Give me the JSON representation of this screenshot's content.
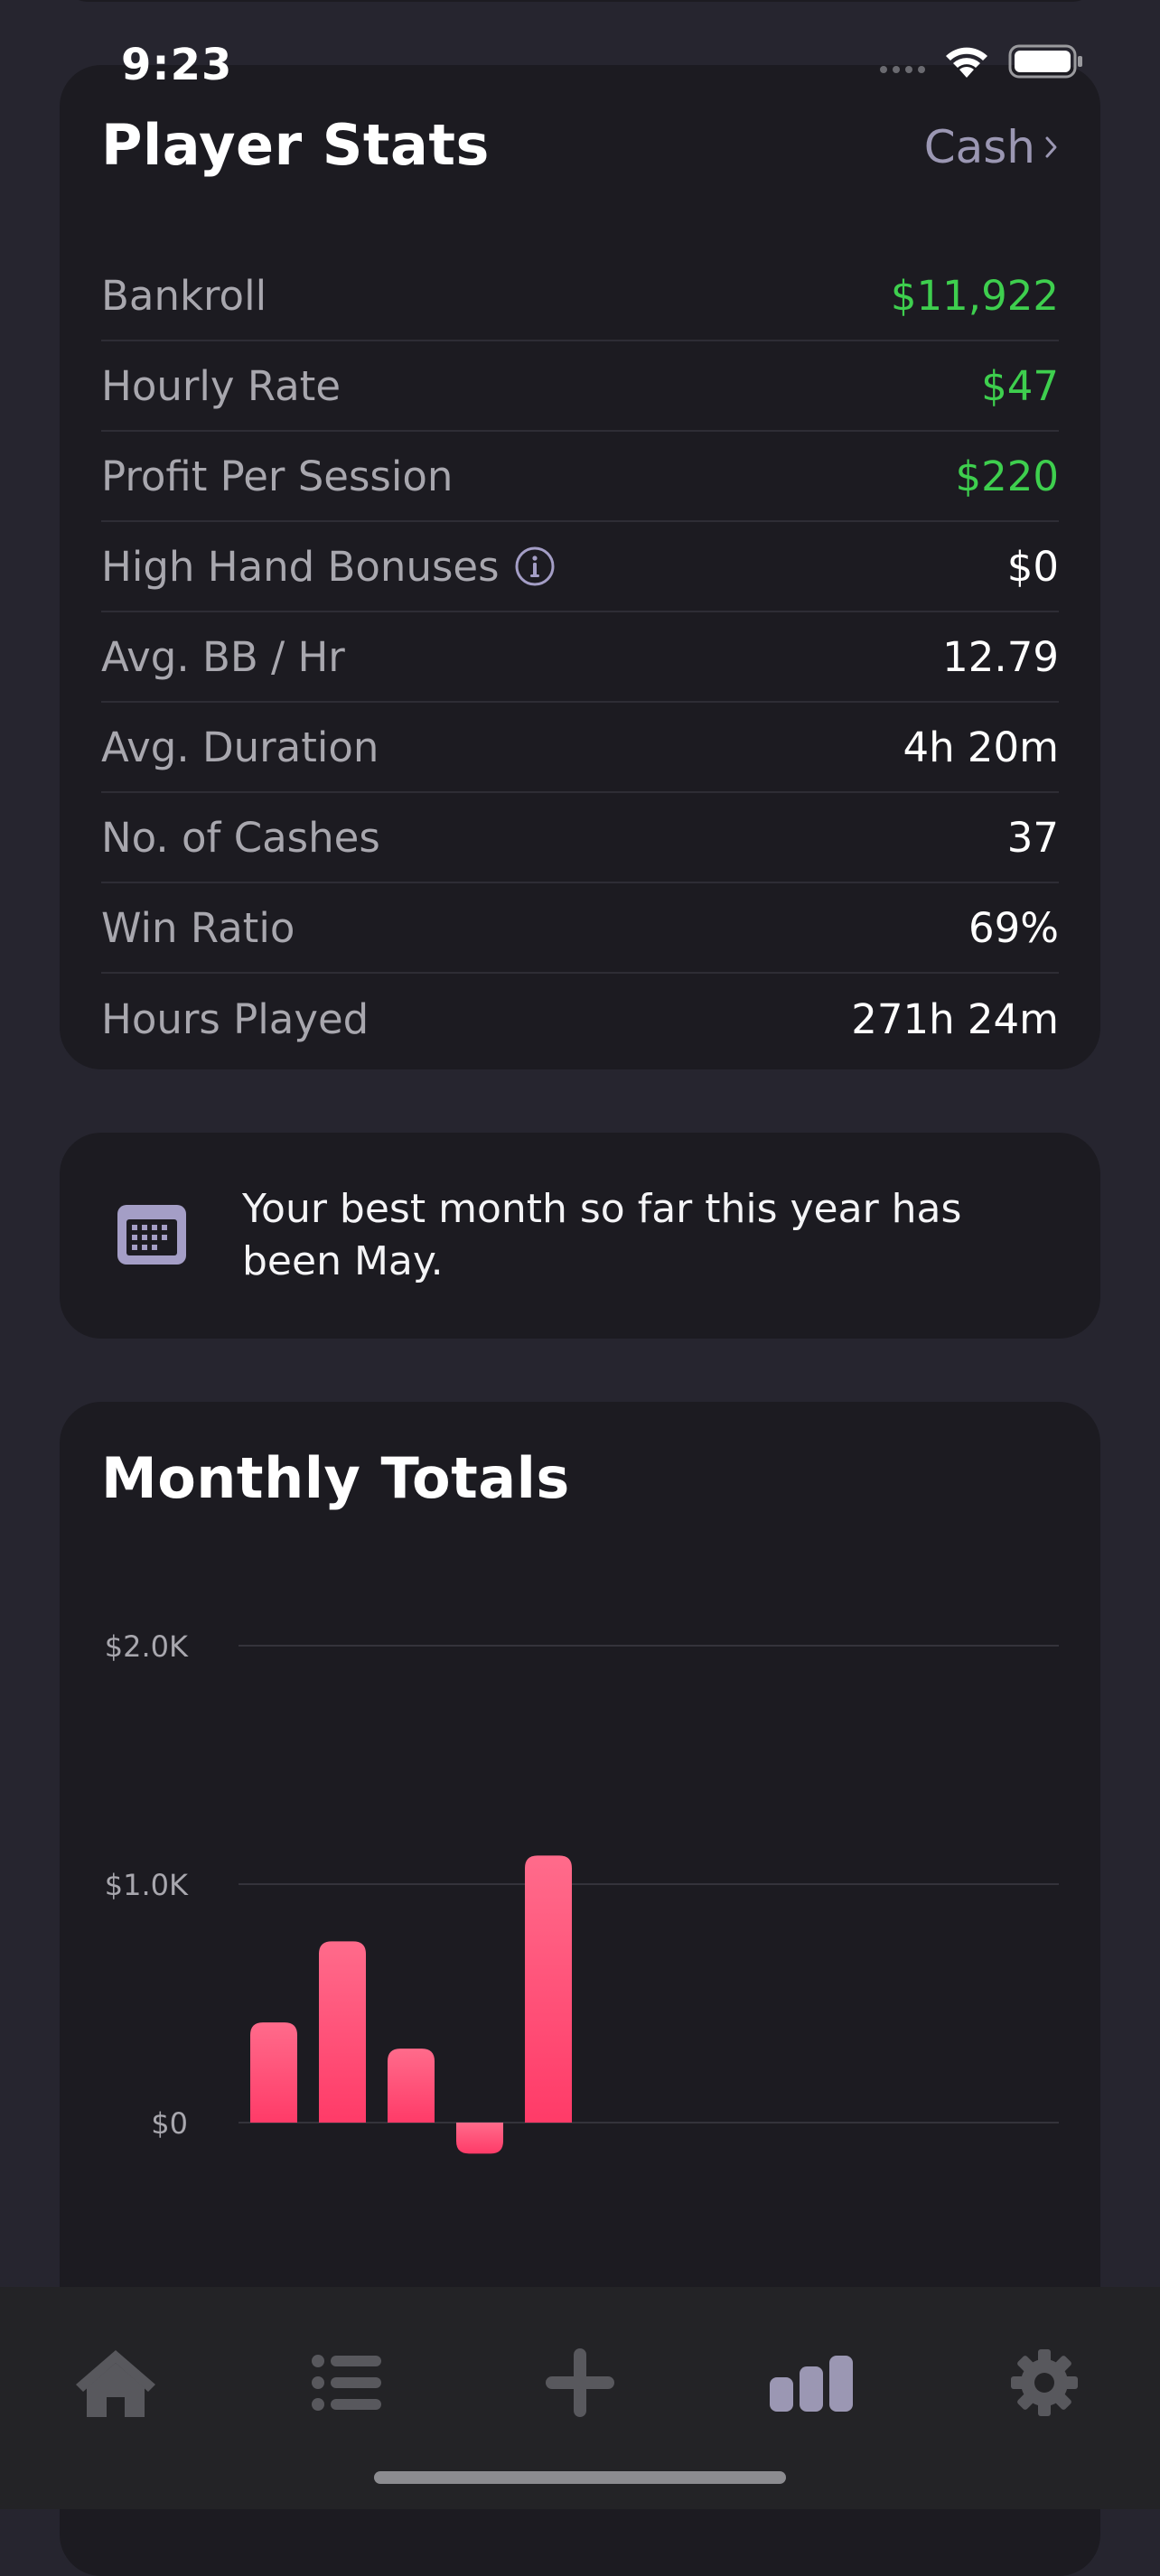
{
  "status_bar": {
    "time": "9:23"
  },
  "player_stats": {
    "title": "Player Stats",
    "mode_link": "Cash",
    "rows": [
      {
        "label": "Bankroll",
        "value": "$11,922",
        "color": "green"
      },
      {
        "label": "Hourly Rate",
        "value": "$47",
        "color": "green"
      },
      {
        "label": "Profit Per Session",
        "value": "$220",
        "color": "green"
      },
      {
        "label": "High Hand Bonuses",
        "value": "$0",
        "color": "white",
        "info_icon": true
      },
      {
        "label": "Avg. BB / Hr",
        "value": "12.79",
        "color": "white"
      },
      {
        "label": "Avg. Duration",
        "value": "4h 20m",
        "color": "white"
      },
      {
        "label": "No. of Cashes",
        "value": "37",
        "color": "white"
      },
      {
        "label": "Win Ratio",
        "value": "69%",
        "color": "white"
      },
      {
        "label": "Hours Played",
        "value": "271h 24m",
        "color": "white"
      }
    ]
  },
  "insight": {
    "icon": "calendar-icon",
    "text": "Your best month so far this year has been May."
  },
  "monthly_totals": {
    "title": "Monthly Totals"
  },
  "chart_data": {
    "type": "bar",
    "title": "Monthly Totals",
    "categories": [
      "",
      "",
      "",
      "",
      ""
    ],
    "values": [
      420,
      760,
      310,
      -130,
      1120
    ],
    "ylim": [
      -200,
      2000
    ],
    "yticks": [
      {
        "value": 0,
        "label": "$0"
      },
      {
        "value": 1000,
        "label": "$1.0K"
      },
      {
        "value": 2000,
        "label": "$2.0K"
      }
    ],
    "grid": true,
    "bar_color": "#ff3b68"
  },
  "tab_bar": {
    "items": [
      {
        "icon": "home-icon",
        "active": false
      },
      {
        "icon": "list-icon",
        "active": false
      },
      {
        "icon": "plus-icon",
        "active": false
      },
      {
        "icon": "bar-chart-icon",
        "active": true
      },
      {
        "icon": "gear-icon",
        "active": false
      }
    ]
  },
  "colors": {
    "background": "#26252f",
    "card": "#1c1b21",
    "positive": "#3ecf4e",
    "accent": "#9b97b3",
    "bar": "#ff3b68"
  }
}
